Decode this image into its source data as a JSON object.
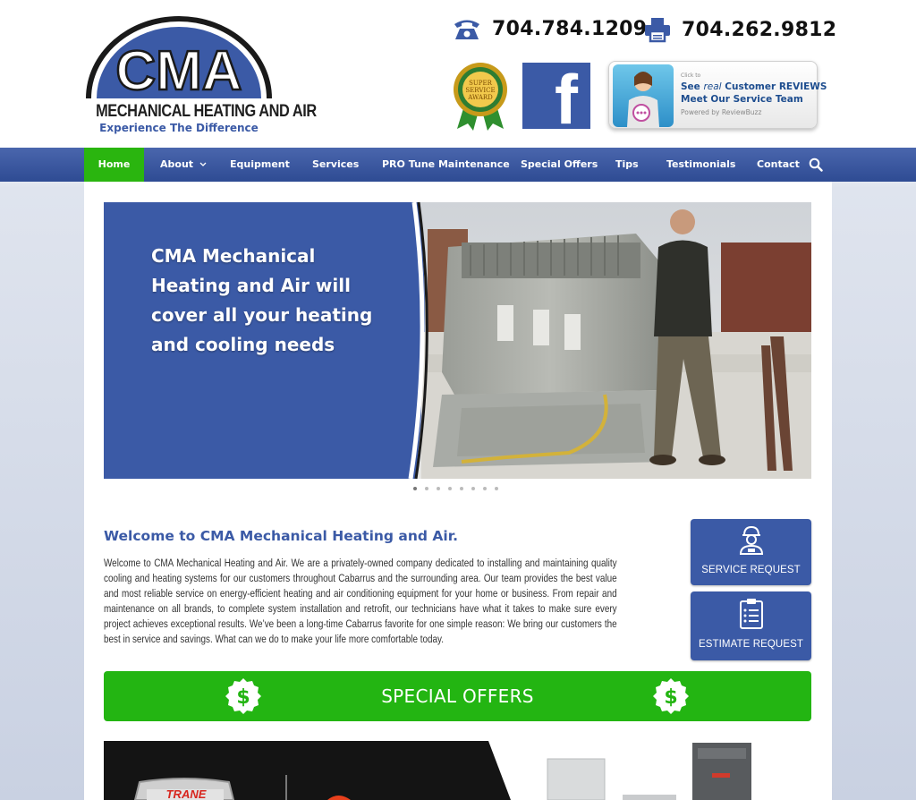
{
  "header": {
    "logo": {
      "wordmark": "CMA",
      "name": "MECHANICAL HEATING AND AIR",
      "tagline": "Experience The Difference"
    },
    "phone": "704.784.1209",
    "fax": "704.262.9812",
    "award": {
      "line1": "SUPER",
      "line2": "SERVICE",
      "line3": "AWARD"
    },
    "facebook_glyph": "f",
    "review_badge": {
      "click": "Click to",
      "line1_prefix": "See ",
      "line1_em": "real",
      "line1_suffix": " Customer REVIEWS",
      "line2": "Meet Our Service Team",
      "line3": "Powered by ReviewBuzz"
    }
  },
  "nav": {
    "items": [
      "Home",
      "About",
      "Equipment",
      "Services",
      "PRO Tune Maintenance",
      "Special Offers",
      "Tips",
      "Testimonials",
      "Contact"
    ],
    "active": "Home"
  },
  "slider": {
    "headline": "CMA Mechanical Heating and Air will cover all your heating and cooling needs",
    "dot_count": 8,
    "active_dot": 1
  },
  "welcome": {
    "title": "Welcome to CMA Mechanical Heating and Air.",
    "body": "Welcome to CMA Mechanical Heating and Air. We are a privately-owned company dedicated to installing and maintaining quality cooling and heating systems for our customers throughout Cabarrus and the surrounding area. Our team provides the best value and most reliable service on energy-efficient heating and air conditioning equipment for your home or business. From repair and maintenance on all brands, to complete system installation and retrofit, our technicians have what it takes to make sure every project achieves exceptional results. We’ve been a long-time Cabarrus favorite for one simple reason: We bring our customers the best in service and savings. What can we do to make your life more comfortable today."
  },
  "requests": {
    "service": "SERVICE REQUEST",
    "estimate": "ESTIMATE REQUEST"
  },
  "offers": {
    "label": "SPECIAL OFFERS",
    "coin_symbol": "$"
  },
  "promo": {
    "brand": "TRANE"
  },
  "colors": {
    "brand_blue": "#3b5aa6",
    "nav_active_green": "#2ab50f",
    "offers_green": "#23b512"
  }
}
